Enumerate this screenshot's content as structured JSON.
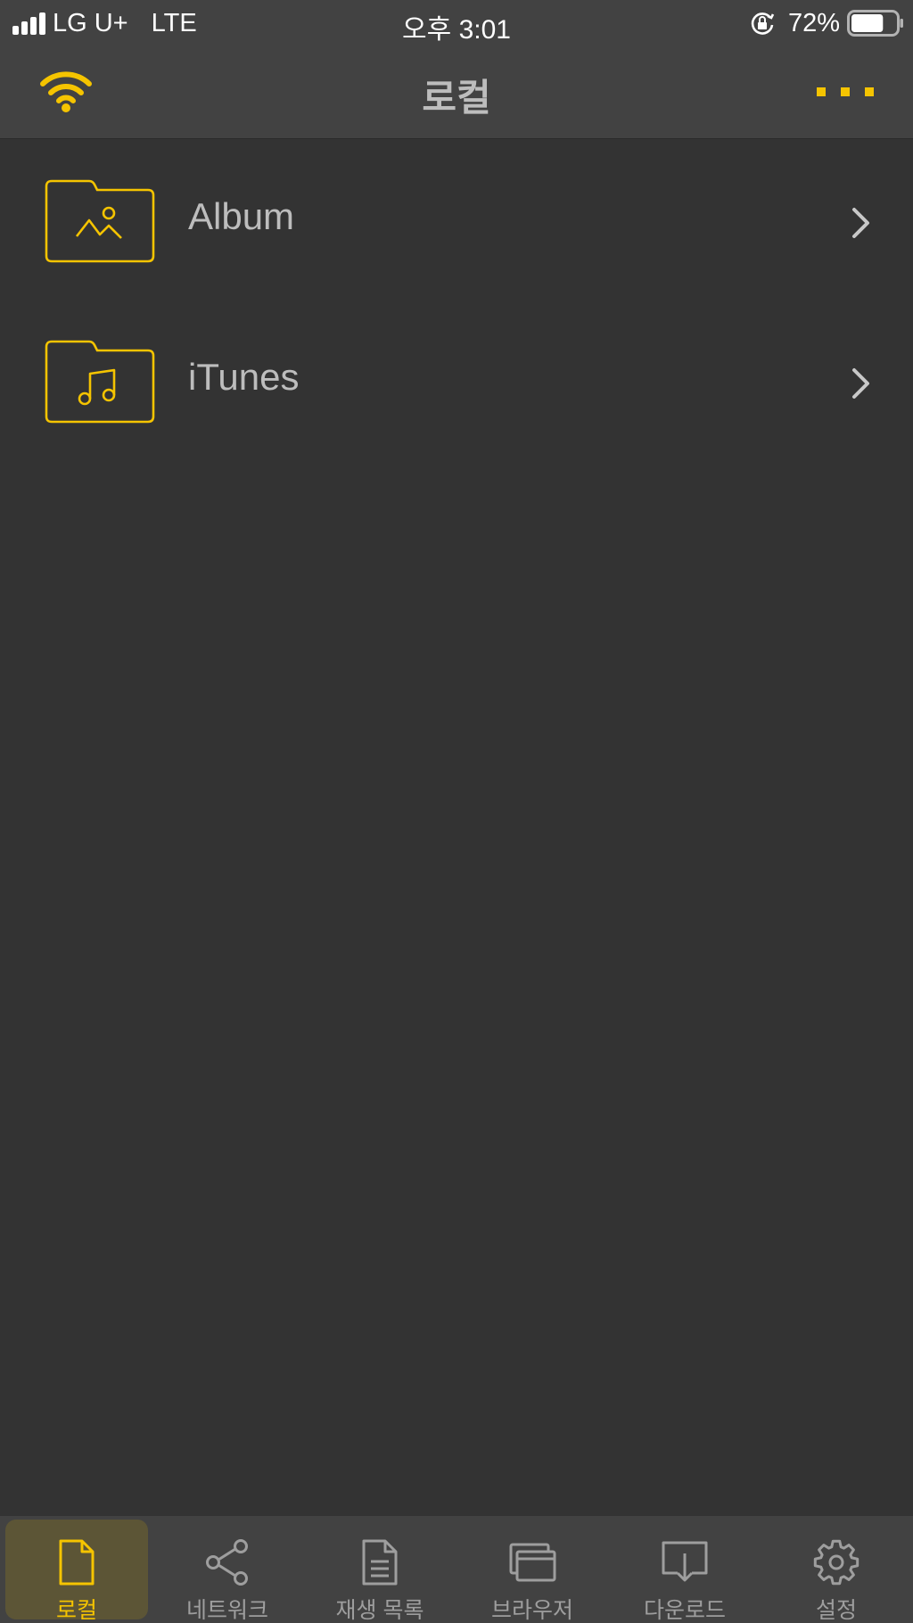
{
  "status_bar": {
    "carrier": "LG U+",
    "network": "LTE",
    "time": "오후 3:01",
    "battery_percent": "72%",
    "battery_level": 0.72,
    "icons": [
      "signal-icon",
      "rotation-lock-icon",
      "battery-icon"
    ]
  },
  "nav": {
    "title": "로컬",
    "left_icon": "wifi-icon",
    "right_icon": "more-icon"
  },
  "list": {
    "items": [
      {
        "label": "Album",
        "icon": "image-folder-icon"
      },
      {
        "label": "iTunes",
        "icon": "music-folder-icon"
      }
    ]
  },
  "tabs": [
    {
      "label": "로컬",
      "icon": "file-icon",
      "active": true
    },
    {
      "label": "네트워크",
      "icon": "share-icon",
      "active": false
    },
    {
      "label": "재생 목록",
      "icon": "document-list-icon",
      "active": false
    },
    {
      "label": "브라우저",
      "icon": "browser-windows-icon",
      "active": false
    },
    {
      "label": "다운로드",
      "icon": "download-icon",
      "active": false
    },
    {
      "label": "설정",
      "icon": "gear-icon",
      "active": false
    }
  ],
  "colors": {
    "accent": "#f5c400",
    "background": "#333333",
    "bar": "#424242",
    "active_tab_bg": "#5c5536",
    "text": "#bdbdbd",
    "inactive": "#9e9e9e"
  }
}
